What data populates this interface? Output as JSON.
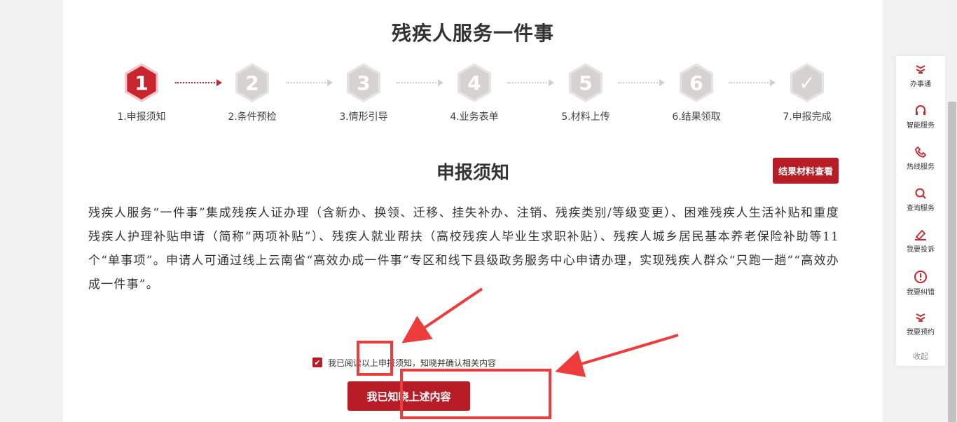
{
  "page": {
    "title": "残疾人服务一件事"
  },
  "steps": [
    {
      "number": "1",
      "label": "1.申报须知",
      "active": true
    },
    {
      "number": "2",
      "label": "2.条件预检",
      "active": false
    },
    {
      "number": "3",
      "label": "3.情形引导",
      "active": false
    },
    {
      "number": "4",
      "label": "4.业务表单",
      "active": false
    },
    {
      "number": "5",
      "label": "5.材料上传",
      "active": false
    },
    {
      "number": "6",
      "label": "6.结果领取",
      "active": false
    },
    {
      "number": "✓",
      "label": "7.申报完成",
      "active": false
    }
  ],
  "notice": {
    "title": "申报须知",
    "result_button": "结果材料查看",
    "body": "残疾人服务“一件事”集成残疾人证办理（含新办、换领、迁移、挂失补办、注销、残疾类别/等级变更）、困难残疾人生活补贴和重度残疾人护理补贴申请（简称“两项补贴”）、残疾人就业帮扶（高校残疾人毕业生求职补贴）、残疾人城乡居民基本养老保险补助等11个“单事项”。申请人可通过线上云南省“高效办成一件事”专区和线下县级政务服务中心申请办理，实现残疾人群众“只跑一趟”“高效办成一件事”。"
  },
  "agreement": {
    "checked": true,
    "text": "我已阅读以上申报须知，知晓并确认相关内容",
    "confirm_button": "我已知晓上述内容"
  },
  "sidebar": {
    "items": [
      {
        "label": "办事通",
        "icon": "banshitong-icon"
      },
      {
        "label": "智能服务",
        "icon": "headset-icon"
      },
      {
        "label": "热线服务",
        "icon": "phone-icon"
      },
      {
        "label": "查询服务",
        "icon": "search-icon"
      },
      {
        "label": "我要投诉",
        "icon": "complaint-icon"
      },
      {
        "label": "我要纠错",
        "icon": "exclamation-icon"
      },
      {
        "label": "我要预约",
        "icon": "appointment-icon"
      }
    ],
    "collapse": "收起"
  },
  "colors": {
    "brand": "#b81c25",
    "annotation": "#ee3b3b"
  }
}
